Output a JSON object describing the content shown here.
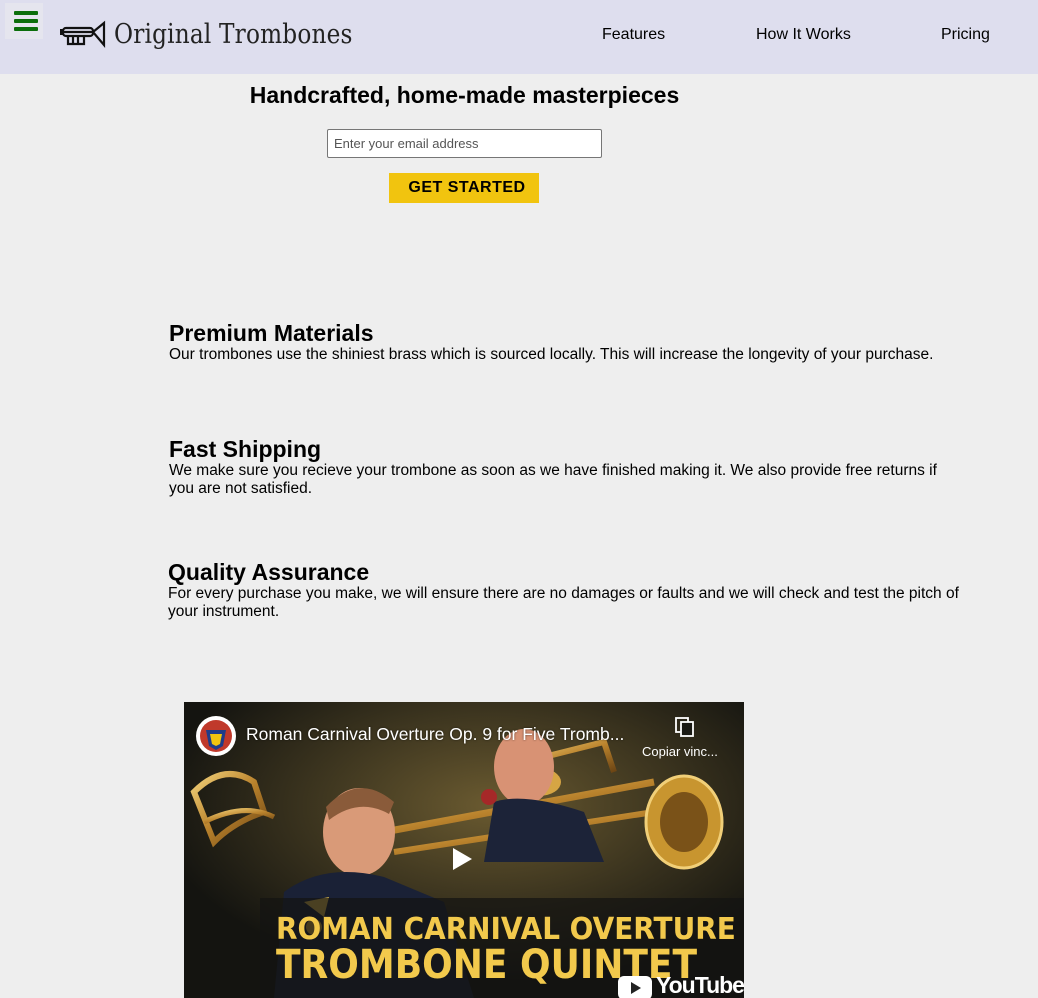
{
  "header": {
    "logo_text": "Original Trombones",
    "nav": [
      {
        "label": "Features"
      },
      {
        "label": "How It Works"
      },
      {
        "label": "Pricing"
      }
    ]
  },
  "hero": {
    "title": "Handcrafted, home-made masterpieces",
    "email_placeholder": "Enter your email address",
    "cta_label": "GET STARTED"
  },
  "features": [
    {
      "title": "Premium Materials",
      "text": "Our trombones use the shiniest brass which is sourced locally. This will increase the longevity of your purchase."
    },
    {
      "title": "Fast Shipping",
      "text": "We make sure you recieve your trombone as soon as we have finished making it. We also provide free returns if you are not satisfied."
    },
    {
      "title": "Quality Assurance",
      "text": "For every purchase you make, we will ensure there are no damages or faults and we will check and test the pitch of your instrument."
    }
  ],
  "video": {
    "title": "Roman Carnival Overture Op. 9 for Five Tromb...",
    "copy_link_label": "Copiar vinc...",
    "banner_line1": "ROMAN CARNIVAL OVERTURE",
    "banner_line2": "TROMBONE QUINTET",
    "platform": "YouTube"
  },
  "colors": {
    "header_bg": "#dedeee",
    "page_bg": "#eeeeee",
    "hamburger": "#0b6e0b",
    "cta": "#f1c40f",
    "banner_text": "#f2c94c"
  },
  "icons": [
    "hamburger-icon",
    "trombone-logo-icon",
    "channel-avatar-icon",
    "copy-link-icon",
    "play-icon",
    "youtube-icon"
  ]
}
